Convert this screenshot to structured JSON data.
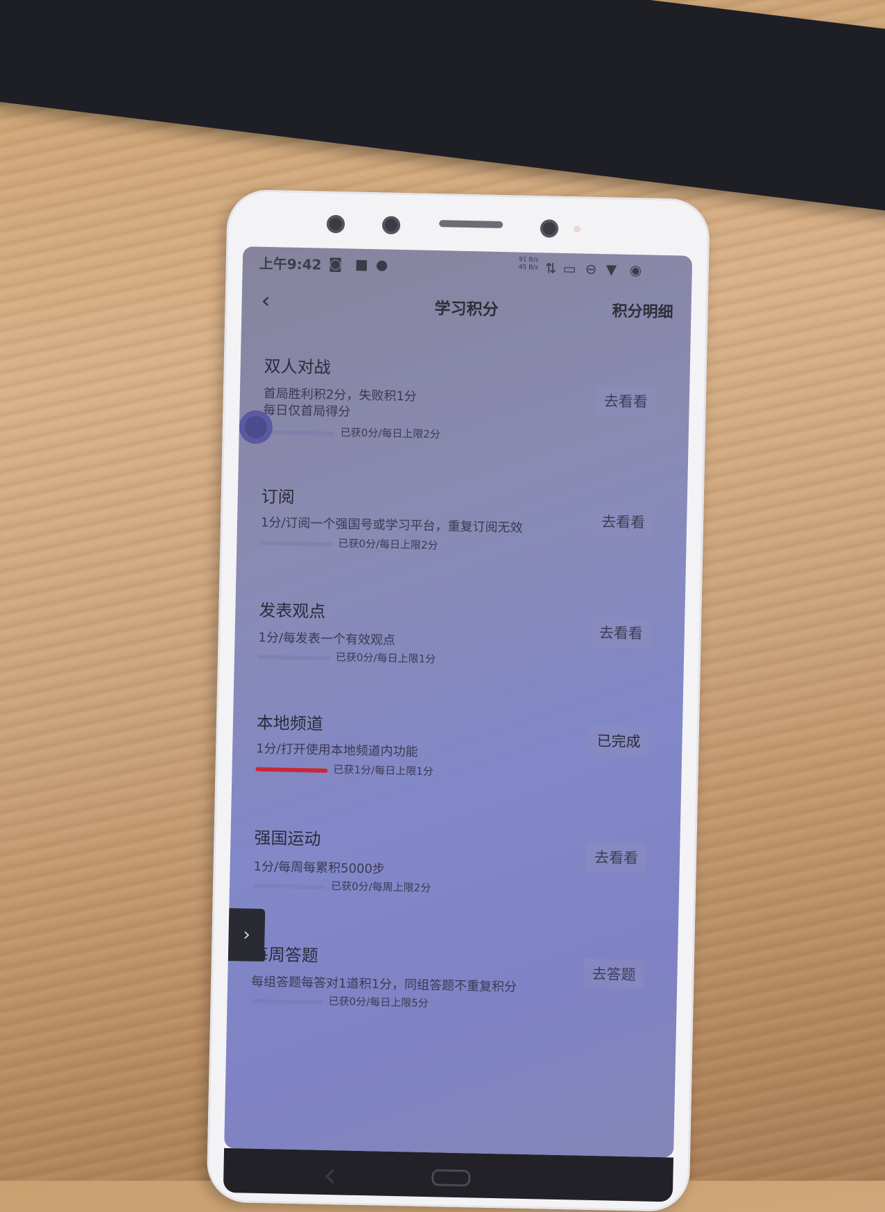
{
  "status_bar": {
    "time": "上午9:42",
    "net_up": "91 B/s",
    "net_down": "45 B/s"
  },
  "header": {
    "title": "学习积分",
    "detail_link": "积分明细"
  },
  "tasks": [
    {
      "title": "双人对战",
      "desc": "首局胜利积2分，失败积1分\n每日仅首局得分",
      "progress": "已获0分/每日上限2分",
      "progress_fraction": 0,
      "action": "去看看"
    },
    {
      "title": "订阅",
      "desc": "1分/订阅一个强国号或学习平台，重复订阅无效",
      "progress": "已获0分/每日上限2分",
      "progress_fraction": 0,
      "action": "去看看"
    },
    {
      "title": "发表观点",
      "desc": "1分/每发表一个有效观点",
      "progress": "已获0分/每日上限1分",
      "progress_fraction": 0,
      "action": "去看看"
    },
    {
      "title": "本地频道",
      "desc": "1分/打开使用本地频道内功能",
      "progress": "已获1分/每日上限1分",
      "progress_fraction": 1,
      "action": "已完成"
    },
    {
      "title": "强国运动",
      "desc": "1分/每周每累积5000步",
      "progress": "已获0分/每周上限2分",
      "progress_fraction": 0,
      "action": "去看看"
    },
    {
      "title": "每周答题",
      "desc": "每组答题每答对1道积1分，同组答题不重复积分",
      "progress": "已获0分/每日上限5分",
      "progress_fraction": 0,
      "action": "去答题"
    }
  ],
  "icons": {
    "back": "chevron-left-icon",
    "side_arrow": "chevron-right-icon"
  },
  "colors": {
    "progress_fill": "#c82838"
  }
}
